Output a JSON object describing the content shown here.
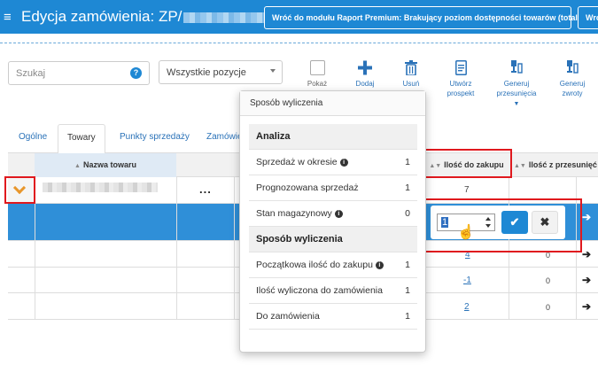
{
  "header": {
    "title": "Edycja zamówienia: ZP/",
    "back_button": "Wróć do modułu Raport Premium: Brakujący poziom dostępności towarów (total sieć)",
    "second_button": "Wró"
  },
  "toolbar": {
    "search_placeholder": "Szukaj",
    "filter_value": "Wszystkie pozycje",
    "tools": {
      "show": "Pokaż",
      "add": "Dodaj",
      "delete": "Usuń",
      "create_prospect_1": "Utwórz",
      "create_prospect_2": "prospekt",
      "gen_shift_1": "Generuj",
      "gen_shift_2": "przesunięcia",
      "gen_returns_1": "Generuj",
      "gen_returns_2": "zwroty"
    }
  },
  "tabs": [
    {
      "label": "Ogólne"
    },
    {
      "label": "Towary"
    },
    {
      "label": "Punkty sprzedaży"
    },
    {
      "label": "Zamówie"
    }
  ],
  "grid": {
    "col_name": "Nazwa towaru",
    "col_ilosc": "Ilość do zakupu",
    "col_przesuniec": "Ilość z przesunięć",
    "row1_dots": "...",
    "row1_ilosc": "7",
    "rows": [
      {
        "ilosc": "4",
        "przes": "0"
      },
      {
        "ilosc": "-1",
        "przes": "0"
      },
      {
        "ilosc": "2",
        "przes": "0"
      }
    ]
  },
  "editor": {
    "value": "1"
  },
  "popover": {
    "title": "Sposób wyliczenia",
    "section1": "Analiza",
    "section2": "Sposób wyliczenia",
    "rows_a": [
      {
        "label": "Sprzedaż w okresie",
        "value": "1",
        "info": true
      },
      {
        "label": "Prognozowana sprzedaż",
        "value": "1",
        "info": false
      },
      {
        "label": "Stan magazynowy",
        "value": "0",
        "info": true
      }
    ],
    "rows_b": [
      {
        "label": "Początkowa ilość do zakupu",
        "value": "1",
        "info": true
      },
      {
        "label": "Ilość wyliczona do zamówienia",
        "value": "1",
        "info": false
      },
      {
        "label": "Do zamówienia",
        "value": "1",
        "info": false
      }
    ]
  },
  "colors": {
    "brand": "#1e88d4",
    "highlight": "#e0191e",
    "selected_row": "#2f8fd8",
    "chevron": "#e8962b"
  },
  "icons": [
    "menu-icon",
    "help-icon",
    "checkbox-icon",
    "plus-icon",
    "trash-icon",
    "document-icon",
    "generate-shift-icon",
    "generate-returns-icon",
    "chevron-down-icon",
    "sort-icon",
    "arrow-right-icon",
    "check-icon",
    "close-icon",
    "hand-cursor-icon",
    "info-icon"
  ]
}
